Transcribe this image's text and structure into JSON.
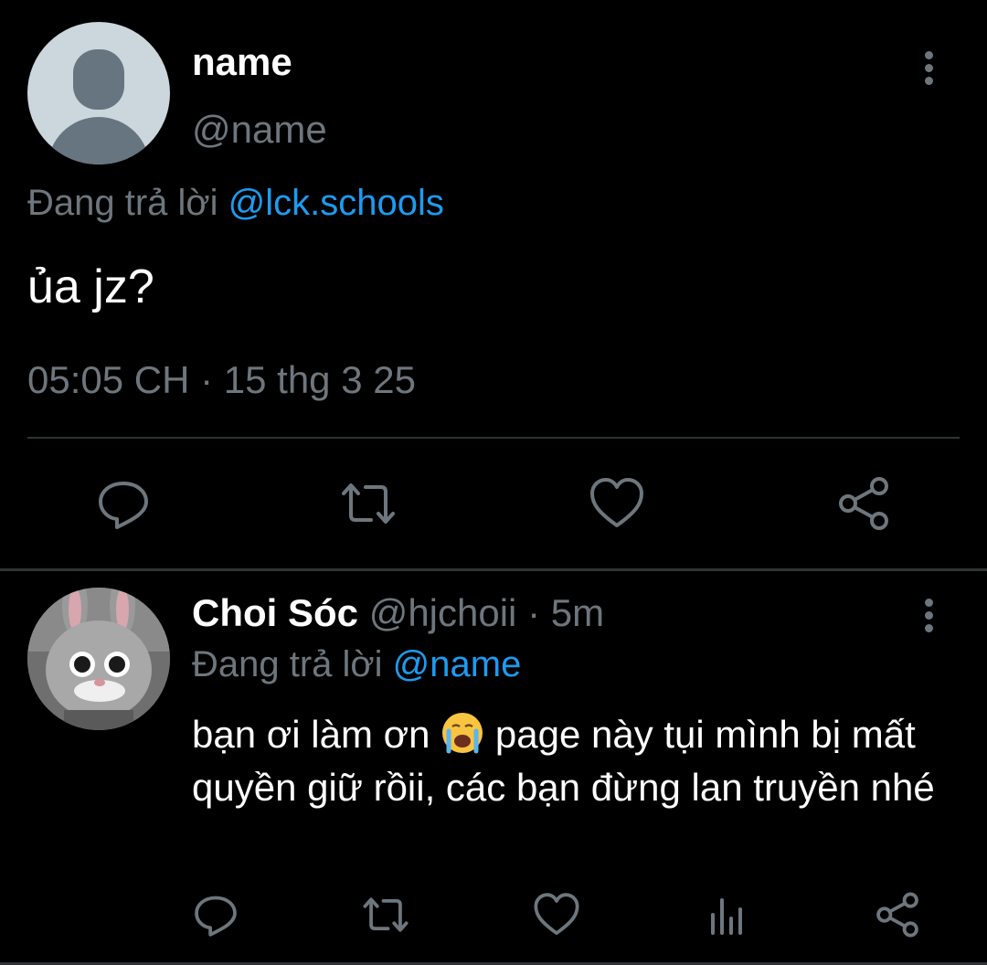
{
  "main_tweet": {
    "name": "name",
    "handle": "@name",
    "replying_prefix": "Đang trả lời ",
    "replying_to": "@lck.schools",
    "text": "ủa jz?",
    "timestamp": "05:05 CH · 15 thg 3 25",
    "actions": [
      "reply-icon",
      "retweet-icon",
      "like-icon",
      "share-icon"
    ]
  },
  "reply": {
    "name": "Choi Sóc",
    "handle": "@hjchoii",
    "dot": "·",
    "age": "5m",
    "replying_prefix": "Đang trả lời ",
    "replying_to": "@name",
    "text_before_emoji": "bạn ơi làm ơn ",
    "emoji": "crying-face-emoji",
    "text_after_emoji": " page này tụi mình bị mất quyền giữ rồii, các bạn đừng lan truyền nhé",
    "actions": [
      "reply-icon",
      "retweet-icon",
      "like-icon",
      "analytics-icon",
      "share-icon"
    ]
  },
  "colors": {
    "background": "#000000",
    "text": "#ffffff",
    "secondary": "#6e767d",
    "accent": "#1d9bf0",
    "divider": "#2f3336"
  }
}
